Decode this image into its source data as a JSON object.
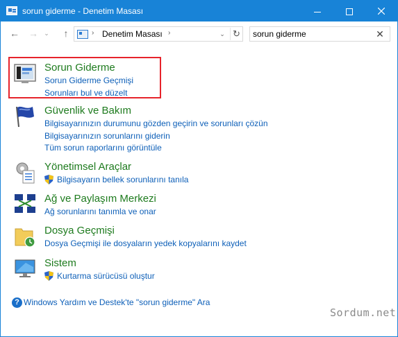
{
  "window": {
    "title": "sorun giderme - Denetim Masası",
    "controls": {
      "minimize": "minimize-icon",
      "maximize": "maximize-icon",
      "close": "close-icon"
    }
  },
  "navbar": {
    "back_icon": "←",
    "forward_icon": "→",
    "recent_icon": "⌄",
    "up_icon": "↑",
    "breadcrumb": [
      "Denetim Masası"
    ],
    "separator": "›",
    "dropdown_icon": "⌄",
    "refresh_icon": "↻",
    "search_value": "sorun giderme",
    "clear_icon": "✕"
  },
  "results": [
    {
      "heading": "Sorun Giderme",
      "icon": "troubleshooting-icon",
      "links": [
        {
          "text": "Sorun Giderme Geçmişi",
          "shield": false
        },
        {
          "text": "Sorunları bul ve düzelt",
          "shield": false
        }
      ]
    },
    {
      "heading": "Güvenlik ve Bakım",
      "icon": "security-flag-icon",
      "links": [
        {
          "text": "Bilgisayarınızın durumunu gözden geçirin ve sorunları çözün",
          "shield": false
        },
        {
          "text": "Bilgisayarınızın sorunlarını giderin",
          "shield": false
        },
        {
          "text": "Tüm sorun raporlarını görüntüle",
          "shield": false
        }
      ]
    },
    {
      "heading": "Yönetimsel Araçlar",
      "icon": "administrative-tools-icon",
      "links": [
        {
          "text": "Bilgisayarın bellek sorunlarını tanıla",
          "shield": true
        }
      ]
    },
    {
      "heading": "Ağ ve Paylaşım Merkezi",
      "icon": "network-icon",
      "links": [
        {
          "text": "Ağ sorunlarını tanımla ve onar",
          "shield": false
        }
      ]
    },
    {
      "heading": "Dosya Geçmişi",
      "icon": "file-history-icon",
      "links": [
        {
          "text": "Dosya Geçmişi ile dosyaların yedek kopyalarını kaydet",
          "shield": false
        }
      ]
    },
    {
      "heading": "Sistem",
      "icon": "system-icon",
      "links": [
        {
          "text": "Kurtarma sürücüsü oluştur",
          "shield": true
        }
      ]
    }
  ],
  "help": {
    "icon": "?",
    "text": "Windows Yardım ve Destek'te \"sorun giderme\" Ara"
  },
  "watermark": "Sordum.net",
  "colors": {
    "titlebar": "#1883d7",
    "heading": "#1e7b1e",
    "link": "#0d5fb8",
    "highlight": "#e6232b"
  }
}
